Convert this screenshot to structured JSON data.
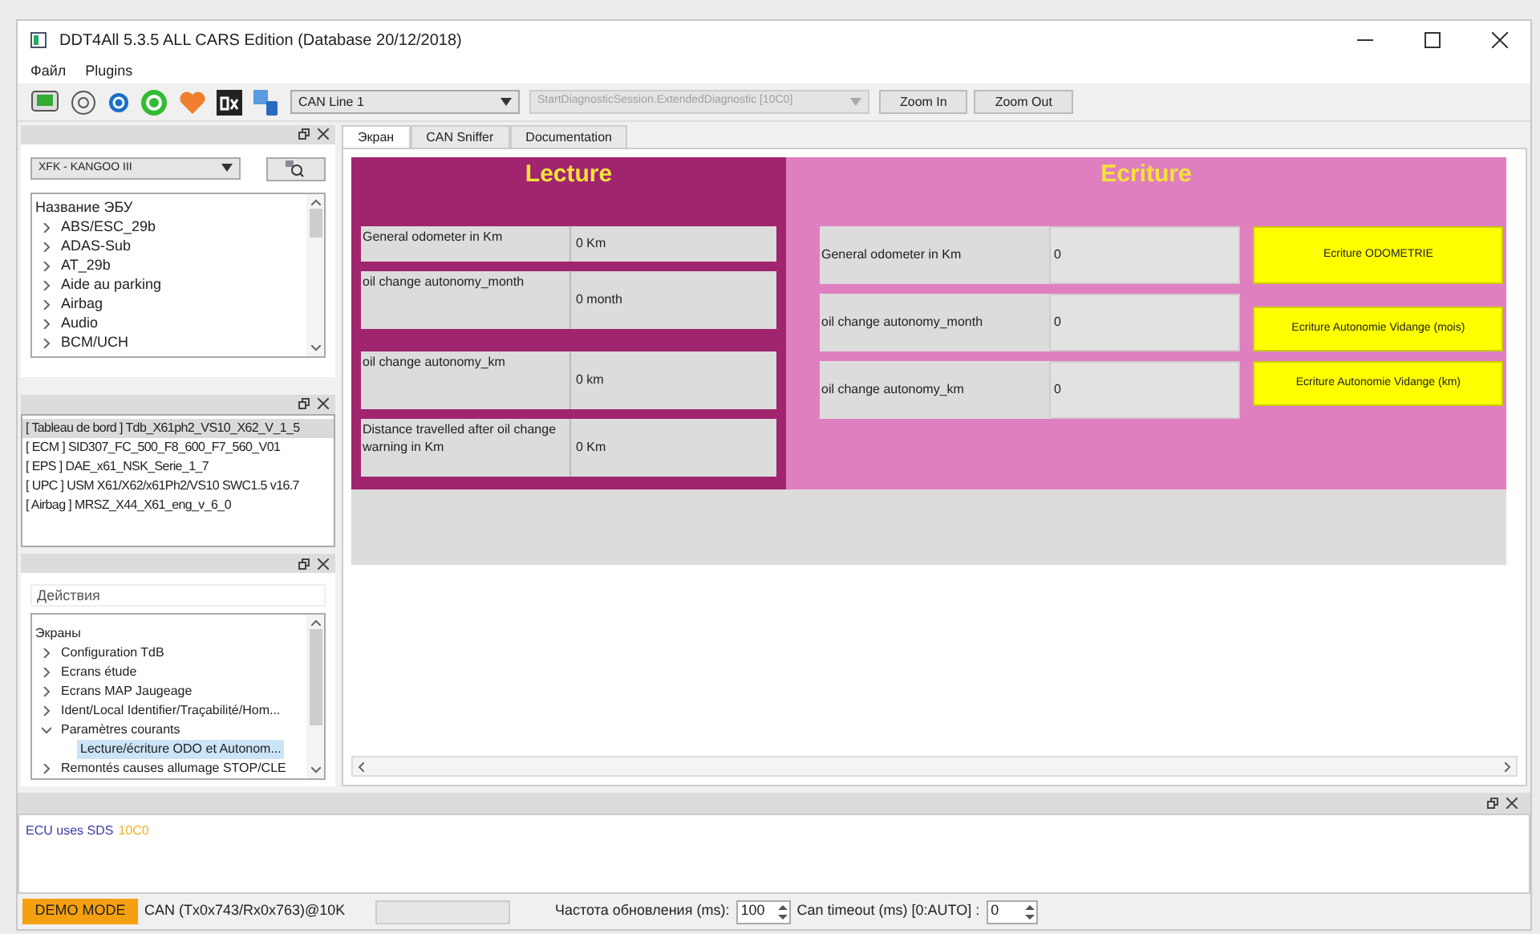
{
  "window": {
    "title": "DDT4All 5.3.5 ALL CARS Edition (Database 20/12/2018)"
  },
  "menu": [
    "Файл",
    "Plugins"
  ],
  "toolbar": {
    "can_line": "CAN Line 1",
    "session": "StartDiagnosticSession.ExtendedDiagnostic [10C0]",
    "session_disabled": true,
    "buttons": [
      "Zoom In",
      "Zoom Out"
    ]
  },
  "vehicle": {
    "value": "XFK - KANGOO III"
  },
  "ecu_tree": {
    "header": "Название ЭБУ",
    "items": [
      {
        "label": "ABS/ESC_29b",
        "expanded": false
      },
      {
        "label": "ADAS-Sub",
        "expanded": false
      },
      {
        "label": "AT_29b",
        "expanded": false
      },
      {
        "label": "Aide au parking",
        "expanded": false
      },
      {
        "label": "Airbag",
        "expanded": false
      },
      {
        "label": "Audio",
        "expanded": false
      },
      {
        "label": "BCM/UCH",
        "expanded": false
      }
    ]
  },
  "ecu_list": [
    {
      "label": "[ Tableau de bord ] Tdb_X61ph2_VS10_X62_V_1_5",
      "selected": true
    },
    {
      "label": "[ ECM ] SID307_FC_500_F8_600_F7_560_V01",
      "selected": false
    },
    {
      "label": "[ EPS ] DAE_x61_NSK_Serie_1_7",
      "selected": false
    },
    {
      "label": "[ UPC ] USM X61/X62/x61Ph2/VS10 SWC1.5 v16.7",
      "selected": false
    },
    {
      "label": "[ Airbag ] MRSZ_X44_X61_eng_v_6_0",
      "selected": false
    }
  ],
  "actions": {
    "placeholder": "Действия"
  },
  "screens_tree": {
    "header": "Экраны",
    "items": [
      {
        "label": "Configuration TdB",
        "expanded": false,
        "selected": false
      },
      {
        "label": "Ecrans étude",
        "expanded": false,
        "selected": false
      },
      {
        "label": "Ecrans MAP Jaugeage",
        "expanded": false,
        "selected": false
      },
      {
        "label": "Ident/Local Identifier/Traçabilité/Hom...",
        "expanded": false,
        "selected": false
      },
      {
        "label": "Paramètres courants",
        "expanded": true,
        "selected": false,
        "children": [
          {
            "label": "Lecture/écriture ODO et Autonom...",
            "selected": true
          }
        ]
      },
      {
        "label": "Remontés causes allumage STOP/CLE",
        "expanded": false,
        "selected": false
      }
    ]
  },
  "tabs": [
    {
      "label": "Экран",
      "selected": true
    },
    {
      "label": "CAN Sniffer",
      "selected": false
    },
    {
      "label": "Documentation",
      "selected": false
    }
  ],
  "screen": {
    "lecture": {
      "title": "Lecture",
      "rows": [
        {
          "label": "General odometer in Km",
          "value": "0 Km"
        },
        {
          "label": "oil change autonomy_month",
          "value": "0 month"
        },
        {
          "label": "oil change autonomy_km",
          "value": "0 km"
        },
        {
          "label": "Distance travelled after oil change warning in Km",
          "value": "0 Km"
        }
      ]
    },
    "ecriture": {
      "title": "Ecriture",
      "rows": [
        {
          "label": "General odometer in Km",
          "value": "0",
          "button": "Ecriture ODOMETRIE"
        },
        {
          "label": "oil change autonomy_month",
          "value": "0",
          "button": "Ecriture Autonomie Vidange (mois)"
        },
        {
          "label": "oil change autonomy_km",
          "value": "0",
          "button": "Ecriture Autonomie Vidange (km)"
        }
      ]
    }
  },
  "log": [
    {
      "text": "ECU uses SDS",
      "color": "#3a3aa0"
    },
    {
      "text": "10C0",
      "color": "#f0b030"
    }
  ],
  "status_bar": {
    "mode": "DEMO MODE",
    "can": "CAN (Tx0x743/Rx0x763)@10K",
    "refresh_label": "Частота обновления (ms):",
    "refresh_value": "100",
    "timeout_label": "Can timeout (ms) [0:AUTO] :",
    "timeout_value": "0"
  }
}
